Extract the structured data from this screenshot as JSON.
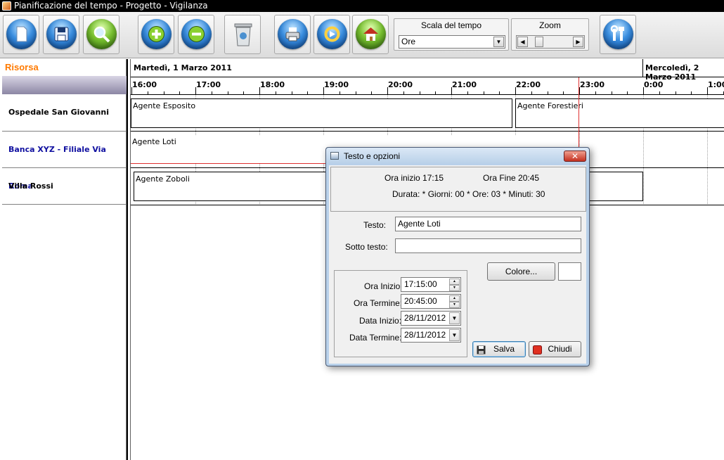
{
  "window": {
    "title": "Pianificazione del tempo  - Progetto - Vigilanza"
  },
  "toolbar": {
    "buttons": [
      {
        "name": "new-icon"
      },
      {
        "name": "save-icon"
      },
      {
        "name": "search-icon"
      },
      {
        "name": "add-icon"
      },
      {
        "name": "remove-icon"
      },
      {
        "name": "recycle-bin-icon"
      },
      {
        "name": "print-icon"
      },
      {
        "name": "refresh-icon"
      },
      {
        "name": "home-icon"
      },
      {
        "name": "tools-icon"
      }
    ],
    "time_scale": {
      "label": "Scala del tempo",
      "value": "Ore"
    },
    "zoom": {
      "label": "Zoom"
    }
  },
  "resources": {
    "header": "Risorsa",
    "rows": [
      "Ospedale San Giovanni",
      "Banca XYZ  - Filiale Via Roma",
      "Villa Rossi"
    ]
  },
  "timeline": {
    "dates": [
      "Martedì, 1 Marzo 2011",
      "Mercoledì, 2 Marzo 2011"
    ],
    "hours": [
      "16:00",
      "17:00",
      "18:00",
      "19:00",
      "20:00",
      "21:00",
      "22:00",
      "23:00",
      "0:00",
      "1:00"
    ],
    "bars": [
      "Agente Esposito",
      "Agente Forestieri",
      "Agente Loti",
      "Agente Zoboli"
    ]
  },
  "dialog": {
    "title": "Testo e opzioni",
    "close_glyph": "✕",
    "start_summary": "Ora inizio 17:15",
    "end_summary": "Ora Fine 20:45",
    "duration_summary": "Durata: * Giorni: 00 * Ore: 03 * Minuti: 30",
    "text_label": "Testo:",
    "text_value": "Agente Loti",
    "subtext_label": "Sotto testo:",
    "subtext_value": "",
    "color_button": "Colore...",
    "start_time_label": "Ora Inizio:",
    "start_time": "17:15:00",
    "end_time_label": "Ora Termine:",
    "end_time": "20:45:00",
    "start_date_label": "Data Inizio:",
    "start_date": "28/11/2012",
    "end_date_label": "Data Termine:",
    "end_date": "28/11/2012",
    "save_button": "Salva",
    "close_button": "Chiudi"
  }
}
